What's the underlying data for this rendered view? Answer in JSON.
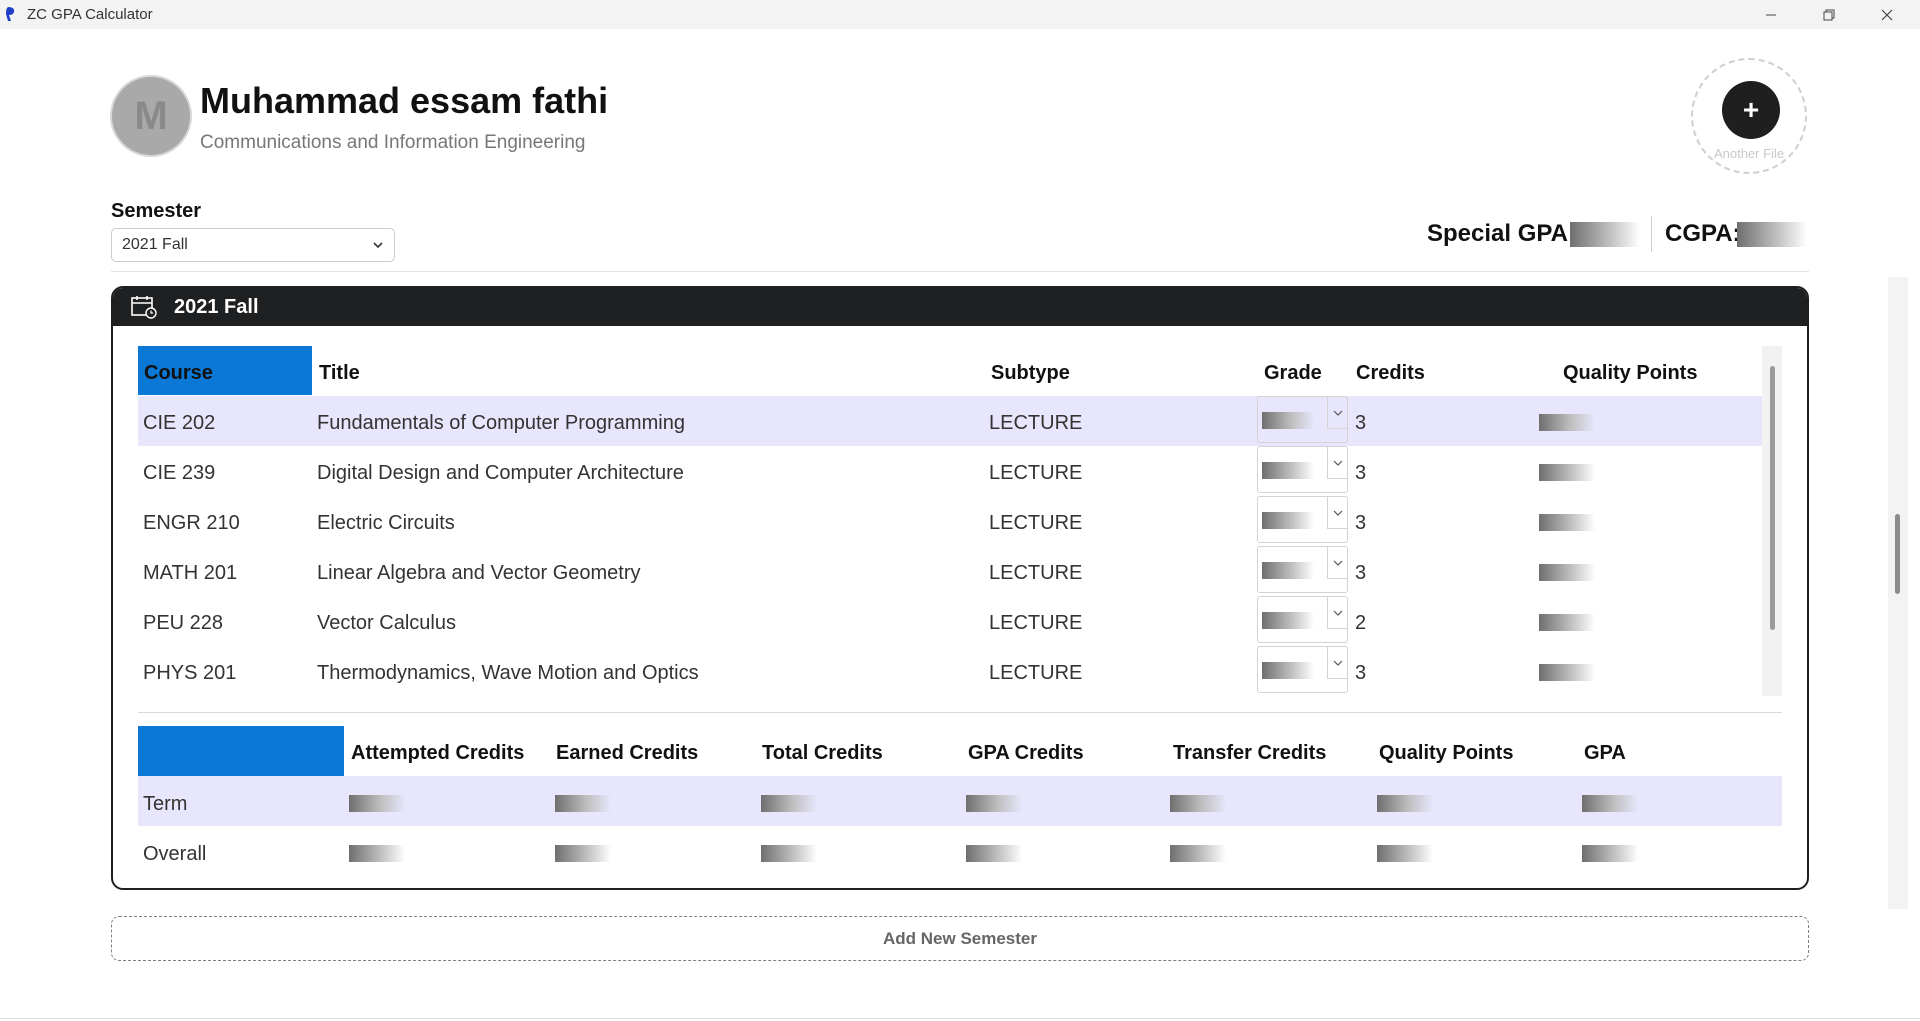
{
  "window": {
    "title": "ZC GPA Calculator",
    "icon": "app-icon"
  },
  "profile": {
    "initial": "M",
    "name": "Muhammad essam fathi",
    "major": "Communications and Information Engineering"
  },
  "another_file": {
    "button": "+",
    "label": "Another File"
  },
  "semester_picker": {
    "label": "Semester",
    "selected": "2021 Fall"
  },
  "summary": {
    "special_gpa_label": "Special GPA:",
    "cgpa_label": "CGPA:"
  },
  "semester_card": {
    "title": "2021 Fall",
    "columns": [
      "Course",
      "Title",
      "Subtype",
      "Grade",
      "Credits",
      "Quality Points"
    ],
    "courses": [
      {
        "code": "CIE 202",
        "title": "Fundamentals of Computer Programming",
        "subtype": "LECTURE",
        "credits": "3"
      },
      {
        "code": "CIE 239",
        "title": "Digital Design and Computer Architecture",
        "subtype": "LECTURE",
        "credits": "3"
      },
      {
        "code": "ENGR 210",
        "title": "Electric Circuits",
        "subtype": "LECTURE",
        "credits": "3"
      },
      {
        "code": "MATH 201",
        "title": "Linear Algebra and Vector Geometry",
        "subtype": "LECTURE",
        "credits": "3"
      },
      {
        "code": "PEU 228",
        "title": "Vector Calculus",
        "subtype": "LECTURE",
        "credits": "2"
      },
      {
        "code": "PHYS 201",
        "title": "Thermodynamics, Wave Motion and Optics",
        "subtype": "LECTURE",
        "credits": "3"
      }
    ],
    "totals_columns": [
      "Attempted Credits",
      "Earned Credits",
      "Total Credits",
      "GPA Credits",
      "Transfer Credits",
      "Quality Points",
      "GPA"
    ],
    "totals_rows": [
      "Term",
      "Overall"
    ]
  },
  "add_semester": {
    "label": "Add New Semester"
  },
  "colors": {
    "accent": "#0a78d4",
    "header_dark": "#1f2022",
    "row_highlight": "#e7e6fc"
  }
}
